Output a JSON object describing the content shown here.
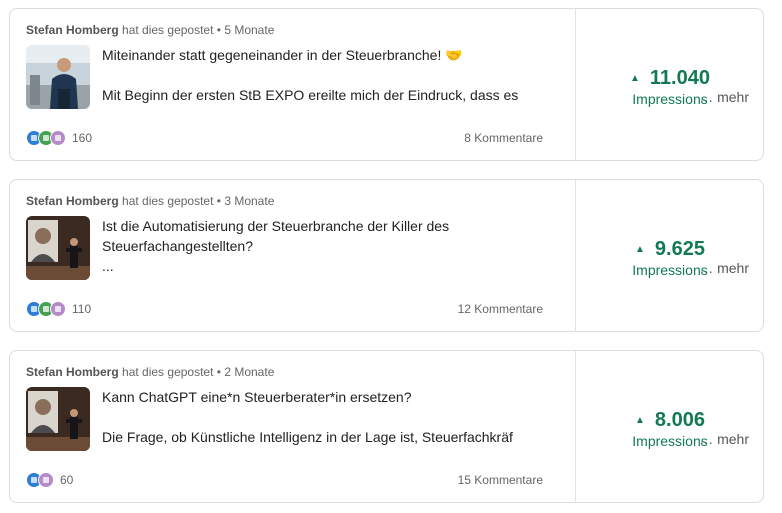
{
  "posts": [
    {
      "author": "Stefan Homberg",
      "action": "hat dies gepostet",
      "age": "5 Monate",
      "lines": [
        "Miteinander statt gegeneinander in der Steuerbranche! 🤝",
        "",
        "Mit Beginn der ersten StB EXPO ereilte mich der Eindruck, dass es"
      ],
      "more": "… mehr",
      "reactions": "160",
      "comments": "8 Kommentare",
      "impressions": "11.040",
      "impressions_label": "Impressions"
    },
    {
      "author": "Stefan Homberg",
      "action": "hat dies gepostet",
      "age": "3 Monate",
      "lines": [
        "Ist die Automatisierung der Steuerbranche der Killer des",
        "Steuerfachangestellten?",
        "..."
      ],
      "more": "… mehr",
      "reactions": "110",
      "comments": "12 Kommentare",
      "impressions": "9.625",
      "impressions_label": "Impressions"
    },
    {
      "author": "Stefan Homberg",
      "action": "hat dies gepostet",
      "age": "2 Monate",
      "lines": [
        "Kann ChatGPT eine*n Steuerberater*in ersetzen?",
        "",
        "Die Frage, ob Künstliche Intelligenz in der Lage ist, Steuerfachkräf"
      ],
      "more": "… mehr",
      "reactions": "60",
      "comments": "15 Kommentare",
      "impressions": "8.006",
      "impressions_label": "Impressions"
    }
  ],
  "separator": "•",
  "colors": {
    "impressions": "#127a53",
    "like": "#2e7dd6",
    "celebrate": "#44a14f",
    "support": "#b68ac8"
  }
}
